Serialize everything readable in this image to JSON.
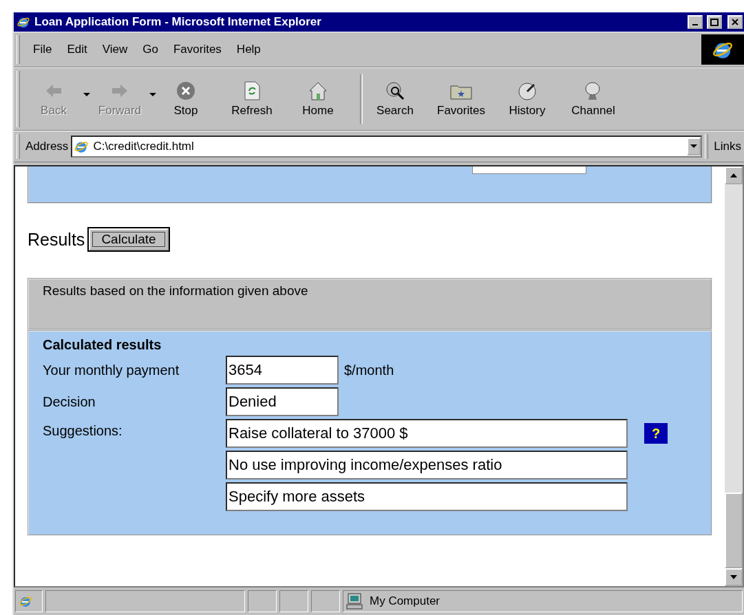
{
  "window": {
    "title": "Loan Application Form - Microsoft Internet Explorer"
  },
  "menu": [
    "File",
    "Edit",
    "View",
    "Go",
    "Favorites",
    "Help"
  ],
  "toolbar": [
    {
      "label": "Back",
      "kind": "back",
      "disabled": true,
      "dropdown": true
    },
    {
      "label": "Forward",
      "kind": "forward",
      "disabled": true,
      "dropdown": true
    },
    {
      "label": "Stop",
      "kind": "stop",
      "disabled": false,
      "dropdown": false
    },
    {
      "label": "Refresh",
      "kind": "refresh",
      "disabled": false,
      "dropdown": false
    },
    {
      "label": "Home",
      "kind": "home",
      "disabled": false,
      "dropdown": false
    },
    {
      "label": "Search",
      "kind": "search",
      "disabled": false,
      "dropdown": false
    },
    {
      "label": "Favorites",
      "kind": "favorites",
      "disabled": false,
      "dropdown": false
    },
    {
      "label": "History",
      "kind": "history",
      "disabled": false,
      "dropdown": false
    },
    {
      "label": "Channel",
      "kind": "channel",
      "disabled": false,
      "dropdown": false
    }
  ],
  "address": {
    "label": "Address",
    "value": "C:\\credit\\credit.html",
    "links": "Links"
  },
  "page": {
    "results_label": "Results",
    "calculate_button": "Calculate",
    "info_panel": "Results based on the information given above",
    "results_panel": {
      "heading": "Calculated results",
      "rows": [
        {
          "label": "Your monthly payment",
          "value": "3654",
          "unit": "$/month"
        },
        {
          "label": "Decision",
          "value": "Denied"
        }
      ],
      "suggestions_label": "Suggestions:",
      "suggestions": [
        "Raise collateral to 37000 $",
        "No use improving income/expenses ratio",
        "Specify more assets"
      ],
      "help_button": "?"
    }
  },
  "status_bar": {
    "zone": "My Computer"
  }
}
